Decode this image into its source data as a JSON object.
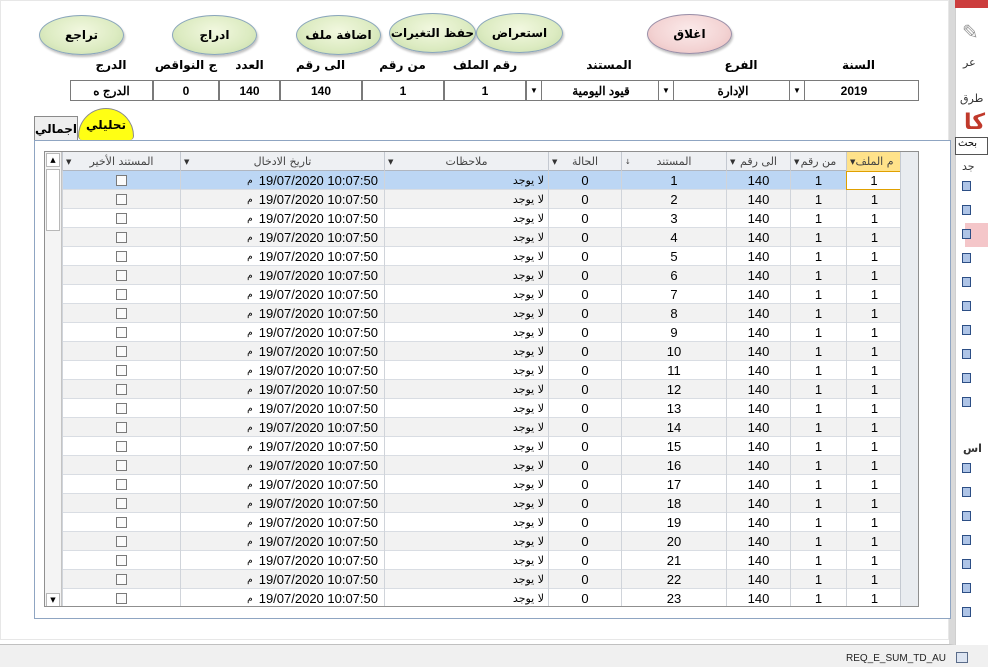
{
  "background": {
    "bottom_item": "REQ_E_SUM_TD_AU",
    "side_labels": [
      "عر",
      "طرق",
      "بحث",
      "جد",
      "اس"
    ],
    "side_heading": "كا",
    "side_box_text": "بحث"
  },
  "buttons": {
    "undo": "تراجع",
    "insert": "ادراج",
    "add_file": "اضافة ملف",
    "save": "حفظ التغيرات",
    "browse": "استعراض",
    "close": "اغلاق"
  },
  "filters": {
    "labels": {
      "degree": "الدرج",
      "shortages": "ج النواقص",
      "count": "العدد",
      "to_no": "الى رقم",
      "from_no": "من رقم",
      "file_no": "رقم الملف",
      "document": "المستند",
      "branch": "الفرع",
      "year": "السنة"
    },
    "values": {
      "degree": "الدرج ه",
      "shortages": "0",
      "count": "140",
      "to_no": "140",
      "from_no": "1",
      "file_no": "1",
      "document": "قيود اليومية",
      "branch": "الإدارة",
      "year": "2019"
    }
  },
  "tabs": {
    "detailed": "تحليلي",
    "summary": "اجمالي"
  },
  "grid": {
    "headers": {
      "file_no": "م الملف",
      "from_no": "من رقم",
      "to_no": "الى رقم",
      "document": "المستند",
      "status": "الحالة",
      "notes": "ملاحظات",
      "entry_date": "تاريخ الادخال",
      "last_doc": "المستند الأخير"
    },
    "rows": [
      {
        "file_no": "1",
        "from_no": "1",
        "to_no": "140",
        "document": "1",
        "status": "0",
        "notes": "لا يوجد",
        "date": "19/07/2020 10:07:50",
        "ampm": "م"
      },
      {
        "file_no": "1",
        "from_no": "1",
        "to_no": "140",
        "document": "2",
        "status": "0",
        "notes": "لا يوجد",
        "date": "19/07/2020 10:07:50",
        "ampm": "م"
      },
      {
        "file_no": "1",
        "from_no": "1",
        "to_no": "140",
        "document": "3",
        "status": "0",
        "notes": "لا يوجد",
        "date": "19/07/2020 10:07:50",
        "ampm": "م"
      },
      {
        "file_no": "1",
        "from_no": "1",
        "to_no": "140",
        "document": "4",
        "status": "0",
        "notes": "لا يوجد",
        "date": "19/07/2020 10:07:50",
        "ampm": "م"
      },
      {
        "file_no": "1",
        "from_no": "1",
        "to_no": "140",
        "document": "5",
        "status": "0",
        "notes": "لا يوجد",
        "date": "19/07/2020 10:07:50",
        "ampm": "م"
      },
      {
        "file_no": "1",
        "from_no": "1",
        "to_no": "140",
        "document": "6",
        "status": "0",
        "notes": "لا يوجد",
        "date": "19/07/2020 10:07:50",
        "ampm": "م"
      },
      {
        "file_no": "1",
        "from_no": "1",
        "to_no": "140",
        "document": "7",
        "status": "0",
        "notes": "لا يوجد",
        "date": "19/07/2020 10:07:50",
        "ampm": "م"
      },
      {
        "file_no": "1",
        "from_no": "1",
        "to_no": "140",
        "document": "8",
        "status": "0",
        "notes": "لا يوجد",
        "date": "19/07/2020 10:07:50",
        "ampm": "م"
      },
      {
        "file_no": "1",
        "from_no": "1",
        "to_no": "140",
        "document": "9",
        "status": "0",
        "notes": "لا يوجد",
        "date": "19/07/2020 10:07:50",
        "ampm": "م"
      },
      {
        "file_no": "1",
        "from_no": "1",
        "to_no": "140",
        "document": "10",
        "status": "0",
        "notes": "لا يوجد",
        "date": "19/07/2020 10:07:50",
        "ampm": "م"
      },
      {
        "file_no": "1",
        "from_no": "1",
        "to_no": "140",
        "document": "11",
        "status": "0",
        "notes": "لا يوجد",
        "date": "19/07/2020 10:07:50",
        "ampm": "م"
      },
      {
        "file_no": "1",
        "from_no": "1",
        "to_no": "140",
        "document": "12",
        "status": "0",
        "notes": "لا يوجد",
        "date": "19/07/2020 10:07:50",
        "ampm": "م"
      },
      {
        "file_no": "1",
        "from_no": "1",
        "to_no": "140",
        "document": "13",
        "status": "0",
        "notes": "لا يوجد",
        "date": "19/07/2020 10:07:50",
        "ampm": "م"
      },
      {
        "file_no": "1",
        "from_no": "1",
        "to_no": "140",
        "document": "14",
        "status": "0",
        "notes": "لا يوجد",
        "date": "19/07/2020 10:07:50",
        "ampm": "م"
      },
      {
        "file_no": "1",
        "from_no": "1",
        "to_no": "140",
        "document": "15",
        "status": "0",
        "notes": "لا يوجد",
        "date": "19/07/2020 10:07:50",
        "ampm": "م"
      },
      {
        "file_no": "1",
        "from_no": "1",
        "to_no": "140",
        "document": "16",
        "status": "0",
        "notes": "لا يوجد",
        "date": "19/07/2020 10:07:50",
        "ampm": "م"
      },
      {
        "file_no": "1",
        "from_no": "1",
        "to_no": "140",
        "document": "17",
        "status": "0",
        "notes": "لا يوجد",
        "date": "19/07/2020 10:07:50",
        "ampm": "م"
      },
      {
        "file_no": "1",
        "from_no": "1",
        "to_no": "140",
        "document": "18",
        "status": "0",
        "notes": "لا يوجد",
        "date": "19/07/2020 10:07:50",
        "ampm": "م"
      },
      {
        "file_no": "1",
        "from_no": "1",
        "to_no": "140",
        "document": "19",
        "status": "0",
        "notes": "لا يوجد",
        "date": "19/07/2020 10:07:50",
        "ampm": "م"
      },
      {
        "file_no": "1",
        "from_no": "1",
        "to_no": "140",
        "document": "20",
        "status": "0",
        "notes": "لا يوجد",
        "date": "19/07/2020 10:07:50",
        "ampm": "م"
      },
      {
        "file_no": "1",
        "from_no": "1",
        "to_no": "140",
        "document": "21",
        "status": "0",
        "notes": "لا يوجد",
        "date": "19/07/2020 10:07:50",
        "ampm": "م"
      },
      {
        "file_no": "1",
        "from_no": "1",
        "to_no": "140",
        "document": "22",
        "status": "0",
        "notes": "لا يوجد",
        "date": "19/07/2020 10:07:50",
        "ampm": "م"
      },
      {
        "file_no": "1",
        "from_no": "1",
        "to_no": "140",
        "document": "23",
        "status": "0",
        "notes": "لا يوجد",
        "date": "19/07/2020 10:07:50",
        "ampm": "م"
      }
    ]
  },
  "colors": {
    "button_green": "#dcebc1",
    "button_close": "#f3d3d3",
    "active_tab": "#ffff14",
    "selected_row": "#bcd6f4",
    "file_header": "#ffe28a"
  }
}
